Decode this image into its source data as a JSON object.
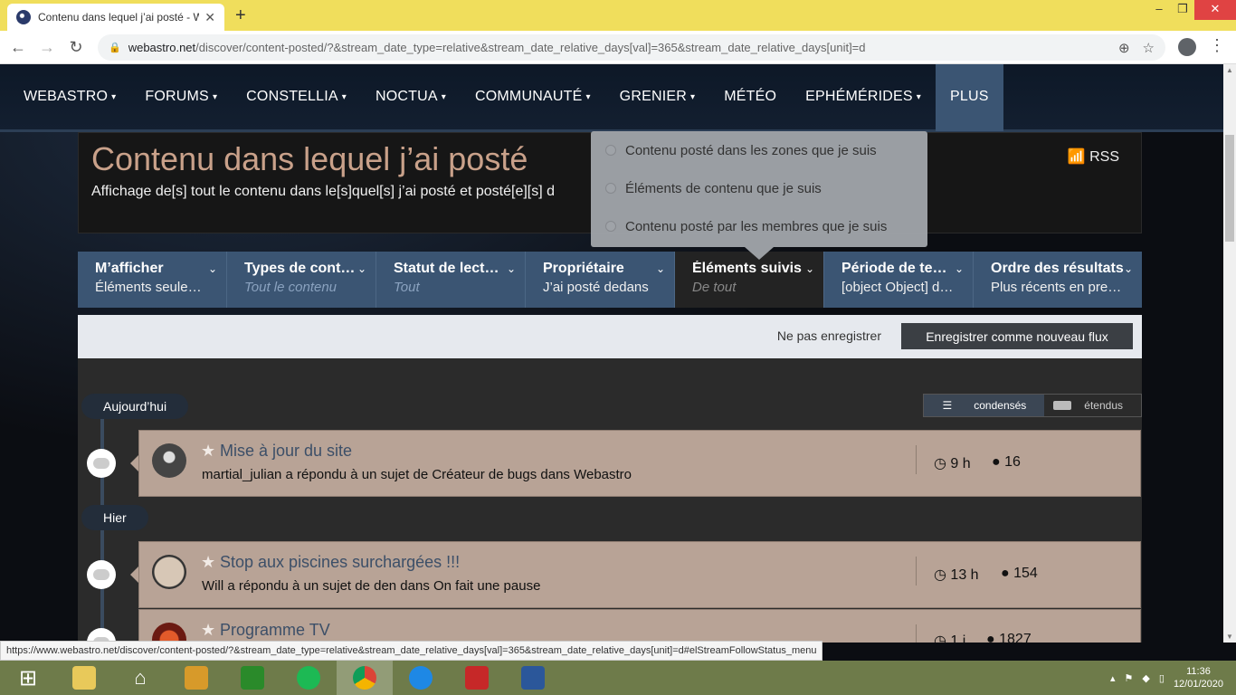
{
  "browser": {
    "tab_title": "Contenu dans lequel j’ai posté - W",
    "new_tab": "+",
    "url_domain": "webastro.net",
    "url_path": "/discover/content-posted/?&stream_date_type=relative&stream_date_relative_days[val]=365&stream_date_relative_days[unit]=d",
    "status_url": "https://www.webastro.net/discover/content-posted/?&stream_date_type=relative&stream_date_relative_days[val]=365&stream_date_relative_days[unit]=d#elStreamFollowStatus_menu"
  },
  "nav": [
    {
      "label": "WEBASTRO",
      "caret": "▾"
    },
    {
      "label": "FORUMS",
      "caret": "▾"
    },
    {
      "label": "CONSTELLIA",
      "caret": "▾"
    },
    {
      "label": "NOCTUA",
      "caret": "▾"
    },
    {
      "label": "COMMUNAUTÉ",
      "caret": "▾"
    },
    {
      "label": "GRENIER",
      "caret": "▾"
    },
    {
      "label": "MÉTÉO",
      "caret": ""
    },
    {
      "label": "EPHÉMÉRIDES",
      "caret": "▾"
    },
    {
      "label": "PLUS",
      "caret": ""
    }
  ],
  "header": {
    "title": "Contenu dans lequel j’ai posté",
    "description": "Affichage de[s] tout le contenu dans le[s]quel[s] j’ai posté et posté[e][s] d",
    "rss": "RSS"
  },
  "filters": [
    {
      "label": "M’afficher",
      "value": "Éléments seulement",
      "muted": false
    },
    {
      "label": "Types de contenu",
      "value": "Tout le contenu",
      "muted": true
    },
    {
      "label": "Statut de lecture",
      "value": "Tout",
      "muted": true
    },
    {
      "label": "Propriétaire",
      "value": "J’ai posté dedans",
      "muted": false
    },
    {
      "label": "Éléments suivis",
      "value": "De tout",
      "muted": true
    },
    {
      "label": "Période de temps",
      "value": "[object Object] derniers jours",
      "muted": false
    },
    {
      "label": "Ordre des résultats",
      "value": "Plus récents en premier",
      "muted": false
    }
  ],
  "dropdown": [
    "Contenu posté dans les zones que je suis",
    "Éléments de contenu que je suis",
    "Contenu posté par les membres que je suis"
  ],
  "savebar": {
    "no_save": "Ne pas enregistrer",
    "save": "Enregistrer comme nouveau flux"
  },
  "view_toggle": {
    "condensed": "condensés",
    "expanded": "étendus"
  },
  "day_labels": {
    "today": "Aujourd’hui",
    "yesterday": "Hier"
  },
  "items": [
    {
      "title": "Mise à jour du site",
      "subtitle": "martial_julian a répondu à un sujet de Créateur de bugs dans Webastro",
      "time": "9 h",
      "replies": "16"
    },
    {
      "title": "Stop aux piscines surchargées !!!",
      "subtitle": "Will a répondu à un sujet de den dans On fait une pause",
      "time": "13 h",
      "replies": "154"
    },
    {
      "title": "Programme TV",
      "subtitle": "",
      "time": "1 j",
      "replies": "1827"
    }
  ],
  "taskbar": {
    "time": "11:36",
    "date": "12/01/2020"
  }
}
